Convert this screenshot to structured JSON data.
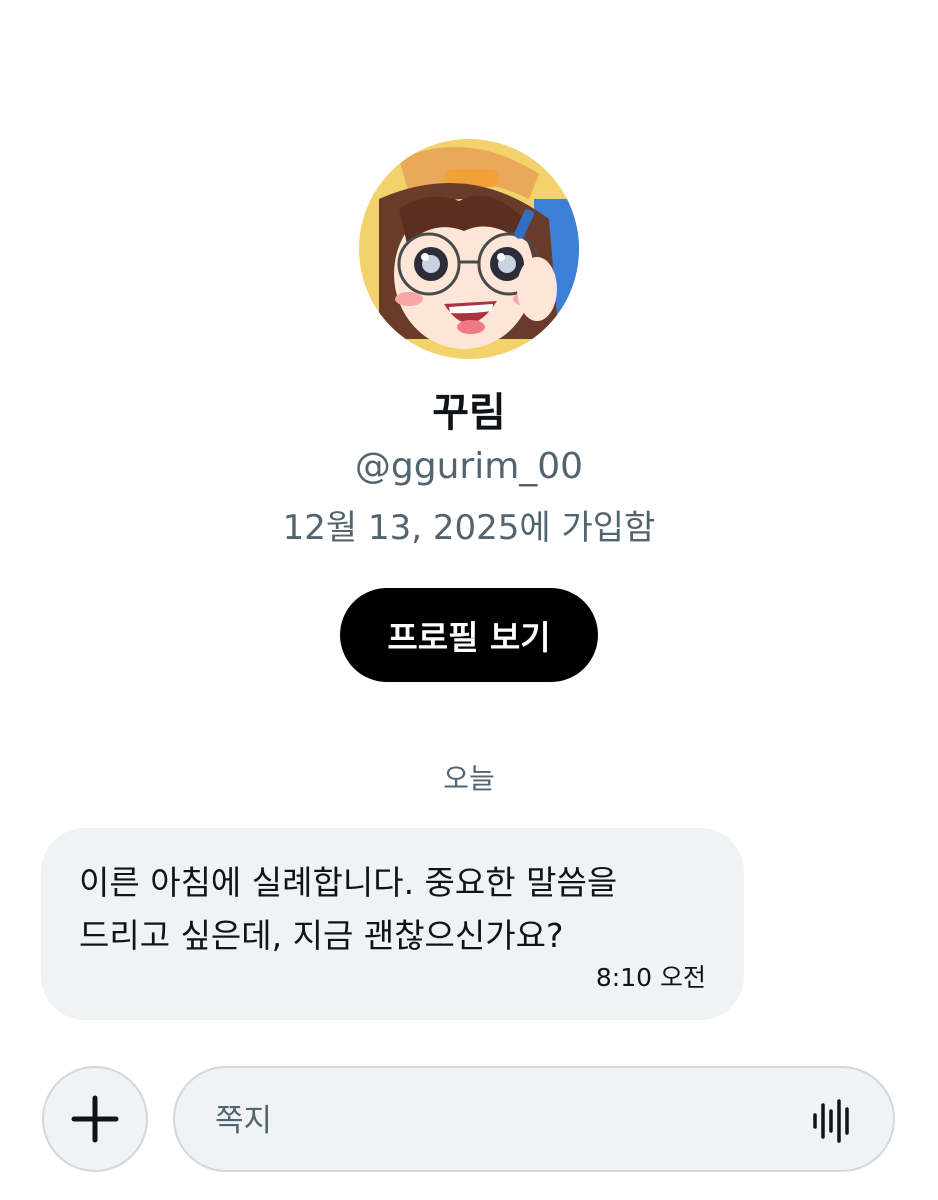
{
  "profile": {
    "display_name": "꾸림",
    "handle": "@ggurim_00",
    "joined": "12월 13, 2025에 가입함",
    "view_profile_label": "프로필 보기",
    "avatar_icon": "anime-avatar"
  },
  "conversation": {
    "day_separator": "오늘",
    "messages": [
      {
        "lines": [
          "이른 아침에 실례합니다. 중요한 말씀을",
          "드리고 싶은데, 지금 괜찮으신가요?"
        ],
        "time": "8:10 오전"
      }
    ]
  },
  "composer": {
    "placeholder": "쪽지",
    "value": "",
    "add_icon": "plus-icon",
    "voice_icon": "voice-waveform-icon"
  },
  "colors": {
    "text_primary": "#0f1419",
    "text_secondary": "#536471",
    "bubble_bg": "#eff3f4",
    "button_bg": "#000000",
    "border": "#cfd9de"
  }
}
